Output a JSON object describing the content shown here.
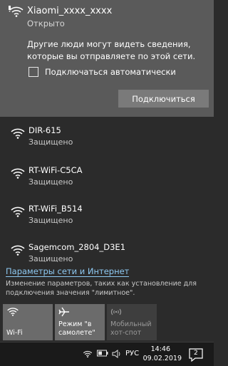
{
  "selected_network": {
    "name": "Xiaomi_xxxx_xxxx",
    "status": "Открыто",
    "description": "Другие люди могут видеть сведения, которые вы отправляете по этой сети.",
    "auto_connect_label": "Подключаться автоматически",
    "auto_connect_checked": false,
    "connect_label": "Подключиться",
    "icon": "wifi-open-icon"
  },
  "networks": [
    {
      "name": "DIR-615",
      "status": "Защищено",
      "icon": "wifi-secured-icon"
    },
    {
      "name": "RT-WiFi-C5CA",
      "status": "Защищено",
      "icon": "wifi-secured-icon"
    },
    {
      "name": "RT-WiFi_B514",
      "status": "Защищено",
      "icon": "wifi-secured-icon"
    },
    {
      "name": "Sagemcom_2804_D3E1",
      "status": "Защищено",
      "icon": "wifi-secured-icon"
    }
  ],
  "settings": {
    "link": "Параметры сети и Интернет",
    "description": "Изменение параметров, таких как установление для подключения значения \"лимитное\"."
  },
  "tiles": [
    {
      "label": "Wi-Fi",
      "icon": "wifi-icon",
      "active": true
    },
    {
      "label": "Режим \"в самолете\"",
      "icon": "airplane-icon",
      "active": true
    },
    {
      "label": "Мобильный хот-спот",
      "icon": "hotspot-icon",
      "active": false
    }
  ],
  "taskbar": {
    "language": "РУС",
    "time": "14:46",
    "date": "09.02.2019",
    "notifications_count": "2",
    "colors": {
      "taskbar": "#1a1a1a",
      "link": "#8ec9f2"
    }
  }
}
